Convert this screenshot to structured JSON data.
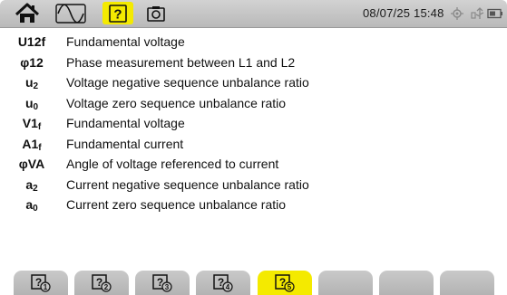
{
  "topbar": {
    "datetime": "08/07/25 15:48",
    "icons": [
      "home-icon",
      "waveform-icon",
      "help-icon",
      "camera-icon",
      "gps-icon",
      "usb-icon",
      "battery-icon"
    ]
  },
  "entries": [
    {
      "symbol": "U12f",
      "sub": "",
      "description": "Fundamental voltage"
    },
    {
      "symbol": "φ12",
      "sub": "",
      "description": "Phase measurement between L1 and L2"
    },
    {
      "symbol": "u",
      "sub": "2",
      "description": "Voltage negative sequence unbalance ratio"
    },
    {
      "symbol": "u",
      "sub": "0",
      "description": "Voltage zero sequence unbalance ratio"
    },
    {
      "symbol": "V1",
      "sub": "f",
      "description": "Fundamental voltage"
    },
    {
      "symbol": "A1",
      "sub": "f",
      "description": "Fundamental current"
    },
    {
      "symbol": "φVA",
      "sub": "",
      "description": "Angle of voltage referenced to current"
    },
    {
      "symbol": "a",
      "sub": "2",
      "description": "Current negative sequence unbalance ratio"
    },
    {
      "symbol": "a",
      "sub": "0",
      "description": "Current zero sequence unbalance ratio"
    }
  ],
  "tabs": [
    {
      "name": "help-page-1",
      "number": "1",
      "active": false
    },
    {
      "name": "help-page-2",
      "number": "2",
      "active": false
    },
    {
      "name": "help-page-3",
      "number": "3",
      "active": false
    },
    {
      "name": "help-page-4",
      "number": "4",
      "active": false
    },
    {
      "name": "help-page-5",
      "number": "5",
      "active": true
    },
    {
      "name": "empty",
      "number": "",
      "active": false
    },
    {
      "name": "empty",
      "number": "",
      "active": false
    },
    {
      "name": "empty",
      "number": "",
      "active": false
    }
  ],
  "colors": {
    "accent": "#f4ea00",
    "bar": "#c4c4c4",
    "text": "#111111"
  }
}
